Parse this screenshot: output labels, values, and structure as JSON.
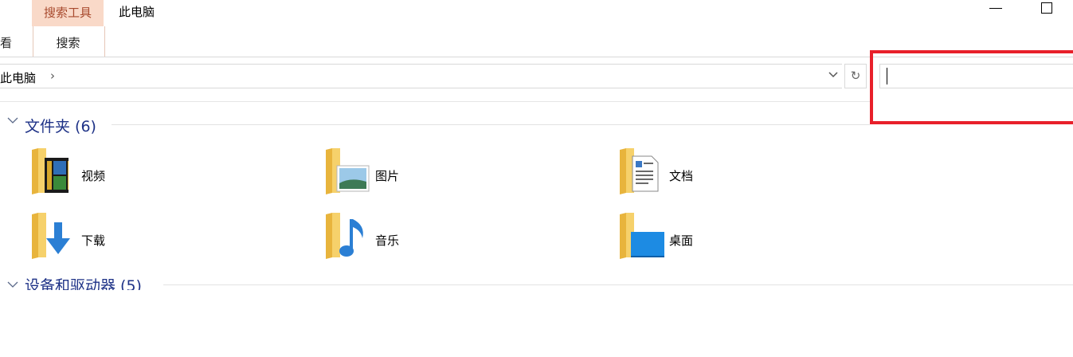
{
  "ribbon": {
    "contextual_tab": "搜索工具",
    "title": "此电脑",
    "tab_view_partial": "看",
    "tab_search": "搜索"
  },
  "address_bar": {
    "path": "此电脑",
    "separator": "›",
    "dropdown_icon": "chevron-down",
    "refresh_icon": "↻"
  },
  "search": {
    "value": ""
  },
  "groups": {
    "folders": {
      "title": "文件夹 (6)",
      "items": [
        {
          "label": "视频",
          "icon": "videos-folder-icon"
        },
        {
          "label": "图片",
          "icon": "pictures-folder-icon"
        },
        {
          "label": "文档",
          "icon": "documents-folder-icon"
        },
        {
          "label": "下载",
          "icon": "downloads-folder-icon"
        },
        {
          "label": "音乐",
          "icon": "music-folder-icon"
        },
        {
          "label": "桌面",
          "icon": "desktop-folder-icon"
        }
      ]
    },
    "devices": {
      "title": "设备和驱动器 (5)"
    }
  },
  "colors": {
    "highlight": "#e8202a",
    "group_title": "#1e3287",
    "contextual_tab_bg": "#f9d9c8",
    "folder": "#f5c54a"
  }
}
